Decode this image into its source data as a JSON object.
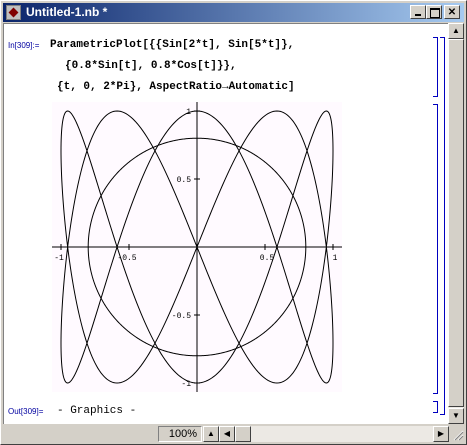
{
  "window": {
    "title": "Untitled-1.nb *"
  },
  "cell_in": {
    "label": "In[309]:=",
    "line1": "ParametricPlot[{{Sin[2*t], Sin[5*t]},",
    "line2": "{0.8*Sin[t], 0.8*Cos[t]}},",
    "line3": "{t, 0, 2*Pi}, AspectRatio→Automatic]"
  },
  "cell_out": {
    "label": "Out[309]=",
    "text": "- Graphics -"
  },
  "status": {
    "zoom": "100%"
  },
  "icons": [
    "app-icon",
    "minimize-icon",
    "maximize-icon",
    "close-icon",
    "scroll-up-icon",
    "scroll-down-icon",
    "scroll-left-icon",
    "scroll-right-icon",
    "resize-grip-icon"
  ],
  "colors": {
    "titlebar": "#0a246a",
    "cell_label": "#0000a0",
    "bracket": "#0000c0"
  },
  "chart_data": {
    "type": "line",
    "x_ticks": [
      "-1",
      "-0.5",
      "0.5",
      "1"
    ],
    "y_ticks": [
      "-1",
      "-0.5",
      "0.5",
      "1"
    ],
    "xlim": [
      -1,
      1
    ],
    "ylim": [
      -1,
      1
    ],
    "series": [
      {
        "x_expr": "sin(2t)",
        "y_expr": "sin(5t)",
        "t_range": [
          0,
          6.283185
        ]
      },
      {
        "x_expr": "0.8 sin(t)",
        "y_expr": "0.8 cos(t)",
        "t_range": [
          0,
          6.283185
        ]
      }
    ]
  }
}
